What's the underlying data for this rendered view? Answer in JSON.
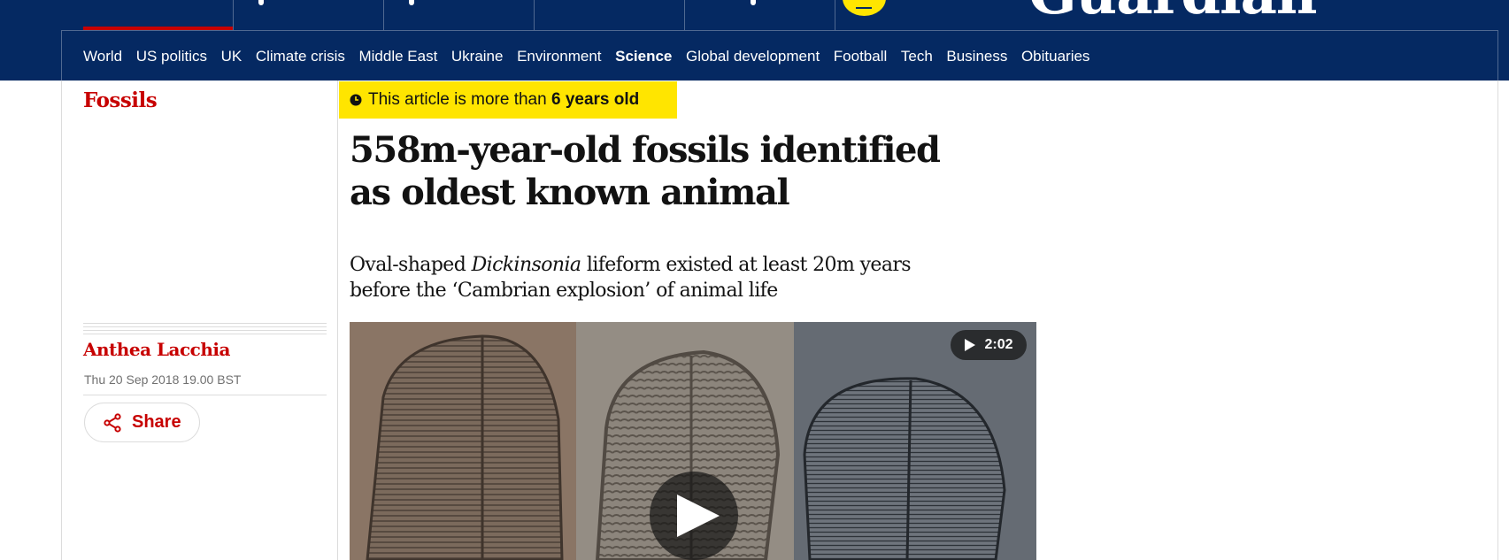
{
  "masthead": {
    "logo_text": "Guardian",
    "accent_color": "#c70000",
    "brand_color": "#052962",
    "support_color": "#ffe500"
  },
  "subnav": {
    "items": [
      {
        "label": "World",
        "active": false
      },
      {
        "label": "US politics",
        "active": false
      },
      {
        "label": "UK",
        "active": false
      },
      {
        "label": "Climate crisis",
        "active": false
      },
      {
        "label": "Middle East",
        "active": false
      },
      {
        "label": "Ukraine",
        "active": false
      },
      {
        "label": "Environment",
        "active": false
      },
      {
        "label": "Science",
        "active": true
      },
      {
        "label": "Global development",
        "active": false
      },
      {
        "label": "Football",
        "active": false
      },
      {
        "label": "Tech",
        "active": false
      },
      {
        "label": "Business",
        "active": false
      },
      {
        "label": "Obituaries",
        "active": false
      }
    ]
  },
  "article": {
    "section": "Fossils",
    "age_notice_prefix": "This article is more than",
    "age_notice_value": "6 years old",
    "age_icon": "clock-icon",
    "headline": "558m-year-old fossils identified as oldest known animal",
    "standfirst_before": "Oval-shaped",
    "standfirst_italic": "Dickinsonia",
    "standfirst_after": "lifeform existed at least 20m years before the ‘Cambrian explosion’ of animal life",
    "byline": "Anthea Lacchia",
    "dateline": "Thu 20 Sep 2018 19.00 BST",
    "share_label": "Share",
    "share_icon": "share-icon"
  },
  "media": {
    "duration": "2:02",
    "play_icon": "play-icon"
  }
}
